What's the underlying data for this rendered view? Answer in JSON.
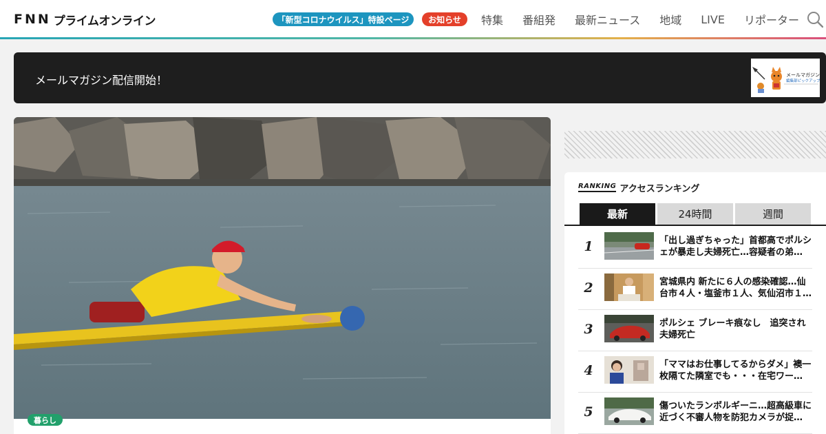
{
  "header": {
    "logo_fnn": "FNN",
    "logo_text": "プライムオンライン",
    "corona_pill": "「新型コロナウイルス」特設ページ",
    "notice_pill": "お知らせ",
    "nav": [
      "特集",
      "番組発",
      "最新ニュース",
      "地域",
      "LIVE",
      "リポーター"
    ]
  },
  "banner": {
    "text": "メールマガジン配信開始！",
    "image_caption_line1": "メールマガジン",
    "image_caption_line2": "編集部ピックアップ"
  },
  "hero": {
    "category": "暮らし"
  },
  "ranking": {
    "logo": "RANKING",
    "title": "アクセスランキング",
    "tabs": [
      "最新",
      "24時間",
      "週間"
    ],
    "active_tab": "最新",
    "items": [
      {
        "num": "1",
        "title": "「出し過ぎちゃった」首都高でポルシェが暴走し夫婦死亡…容疑者の弟…"
      },
      {
        "num": "2",
        "title": "宮城県内 新たに６人の感染確認…仙台市４人・塩釜市１人、気仙沼市１…"
      },
      {
        "num": "3",
        "title": "ポルシェ ブレーキ痕なし　追突され夫婦死亡"
      },
      {
        "num": "4",
        "title": "「ママはお仕事してるからダメ」襖一枚隔てた隣室でも・・・在宅ワー…"
      },
      {
        "num": "5",
        "title": "傷ついたランボルギーニ…超高級車に近づく不審人物を防犯カメラが捉…"
      }
    ]
  },
  "colors": {
    "corona_pill": "#1d95bf",
    "notice_pill": "#e4402a",
    "category_badge": "#22a06b",
    "banner_bg": "#1e1e1e",
    "tab_active": "#1a1a1a"
  },
  "icons": {
    "search": "search-icon"
  }
}
